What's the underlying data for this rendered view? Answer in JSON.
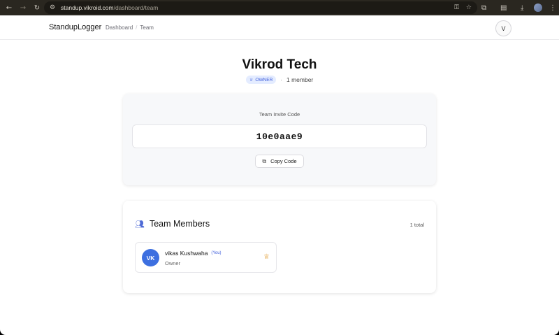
{
  "browser": {
    "url_host": "standup.vikroid.com",
    "url_path": "/dashboard/team"
  },
  "nav": {
    "brand": "StandupLogger",
    "breadcrumbs": [
      "Dashboard",
      "Team"
    ],
    "user_initial": "V"
  },
  "team": {
    "name": "Vikrod Tech",
    "role_badge": "OWNER",
    "member_count_text": "1 member"
  },
  "invite": {
    "label": "Team Invite Code",
    "code": "10e0aae9",
    "copy_button_label": "Copy Code"
  },
  "members": {
    "title": "Team Members",
    "total_text": "1 total",
    "items": [
      {
        "initials": "VK",
        "name": "vikas Kushwaha",
        "you_tag": "(You)",
        "role": "Owner"
      }
    ]
  },
  "colors": {
    "accent": "#3d6fe0",
    "badge_bg": "#e4ecff",
    "crown": "#e09a2c"
  }
}
